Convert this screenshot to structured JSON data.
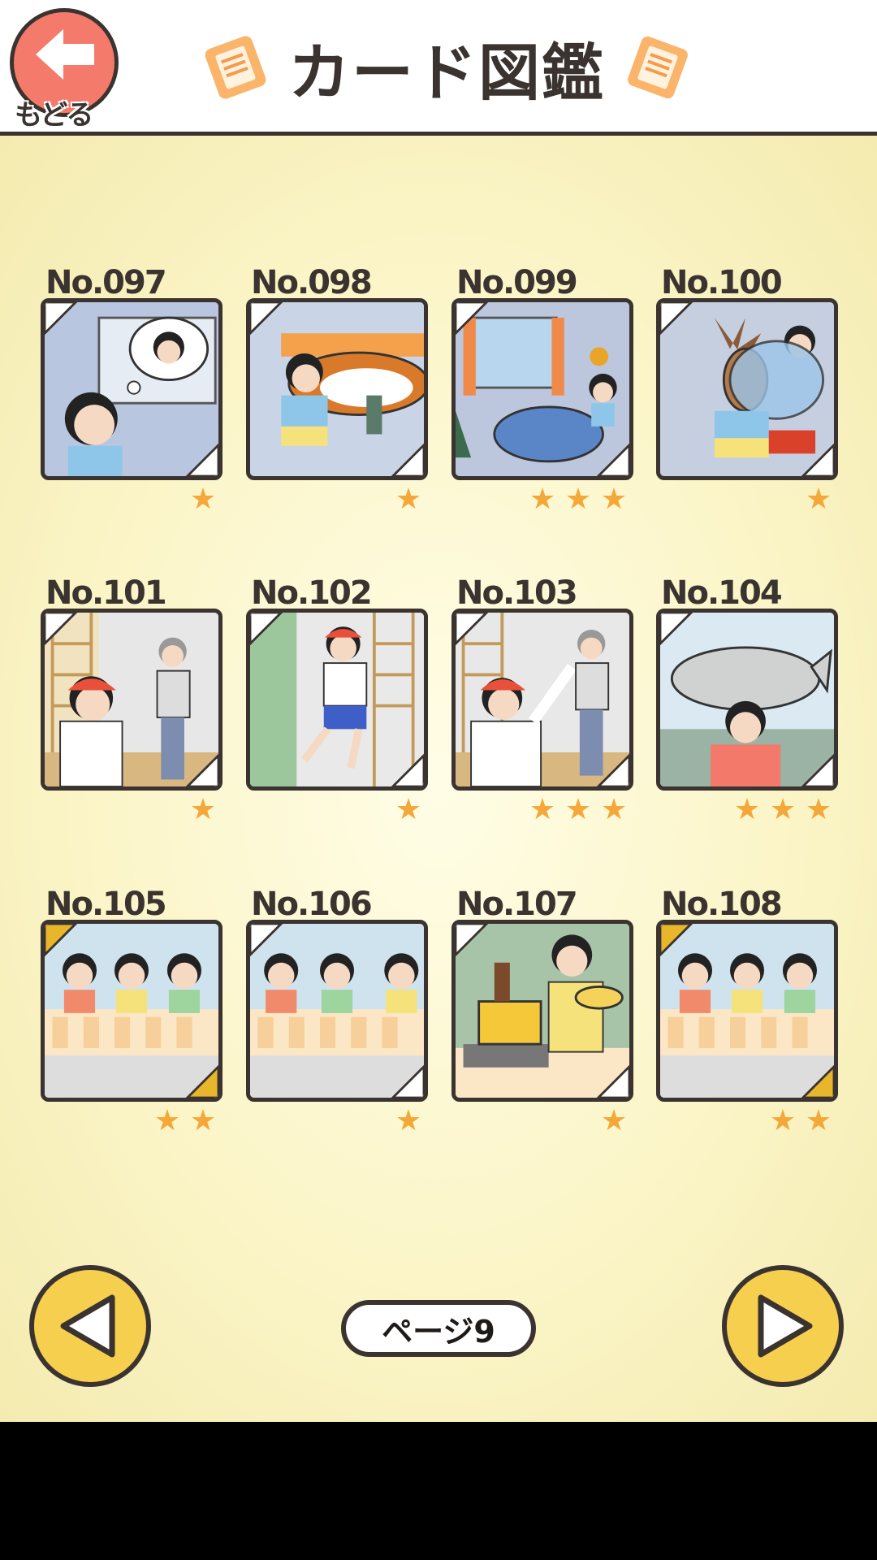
{
  "header": {
    "back_label": "もどる",
    "title": "カード図鑑"
  },
  "cards": [
    {
      "no": "No.097",
      "stars": 1,
      "theme": "dream"
    },
    {
      "no": "No.098",
      "stars": 1,
      "theme": "kotatsu"
    },
    {
      "no": "No.099",
      "stars": 3,
      "theme": "bedroom"
    },
    {
      "no": "No.100",
      "stars": 1,
      "theme": "deer"
    },
    {
      "no": "No.101",
      "stars": 1,
      "theme": "gym-teacher"
    },
    {
      "no": "No.102",
      "stars": 1,
      "theme": "gym-jump"
    },
    {
      "no": "No.103",
      "stars": 3,
      "theme": "gym-wave"
    },
    {
      "no": "No.104",
      "stars": 3,
      "theme": "fish"
    },
    {
      "no": "No.105",
      "stars": 2,
      "theme": "lunch-gold"
    },
    {
      "no": "No.106",
      "stars": 1,
      "theme": "lunch"
    },
    {
      "no": "No.107",
      "stars": 1,
      "theme": "cooking"
    },
    {
      "no": "No.108",
      "stars": 2,
      "theme": "lunch-gold"
    }
  ],
  "pager": {
    "label": "ページ9"
  },
  "colors": {
    "accent_orange": "#f4a83a",
    "back_red": "#f47b6c",
    "nav_yellow": "#f5cf4d",
    "outline": "#3a3330"
  },
  "icons": {
    "back": "arrow-left-icon",
    "prev": "triangle-left-icon",
    "next": "triangle-right-icon",
    "star": "star-icon",
    "title_deco": "card-icon"
  }
}
